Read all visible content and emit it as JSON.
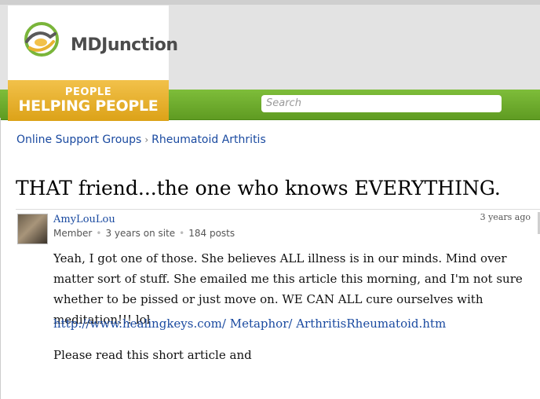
{
  "header": {
    "logo_text": "MDJunction",
    "tagline_top": "PEOPLE",
    "tagline_bottom": "HELPING PEOPLE",
    "search_placeholder": "Search"
  },
  "breadcrumb": {
    "items": [
      "Online Support Groups",
      "Rheumatoid Arthritis"
    ],
    "separator": "›"
  },
  "thread": {
    "title": "THAT friend...the one who knows EVERYTHING."
  },
  "post": {
    "author": "AmyLouLou",
    "role": "Member",
    "tenure": "3 years on site",
    "posts": "184 posts",
    "time": "3 years ago",
    "paragraphs": [
      "Yeah, I got one of those. She believes ALL illness is in our minds. Mind over matter sort of stuff. She emailed me this article this morning, and I'm not sure whether to be pissed or just move on. WE CAN ALL cure ourselves with meditation!!! lol",
      "http://www.healingkeys.com/ Metaphor/ ArthritisRheumatoid.htm",
      "Please read this short article and"
    ]
  },
  "colors": {
    "green": "#6aab2c",
    "gold": "#e8b230",
    "link": "#1a4aa0"
  }
}
